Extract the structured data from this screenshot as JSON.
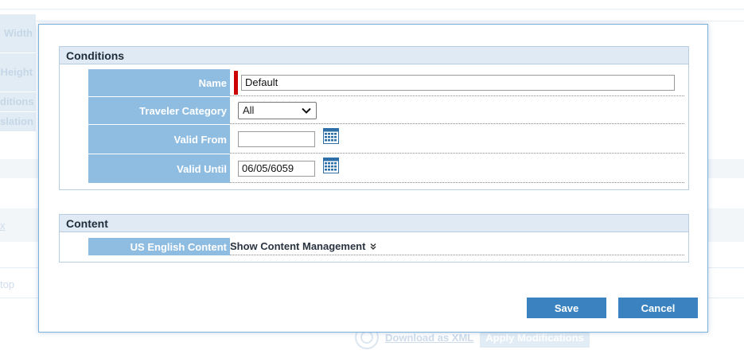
{
  "background": {
    "labels": [
      "Width",
      "Height",
      "ditions",
      "slation"
    ],
    "link_x": "x",
    "link_top": "top",
    "download_label": "Download as XML",
    "apply_label": "Apply Modifications"
  },
  "conditions": {
    "header": "Conditions",
    "name_label": "Name",
    "name_value": "Default",
    "traveler_label": "Traveler Category",
    "traveler_value": "All",
    "valid_from_label": "Valid From",
    "valid_from_value": "",
    "valid_until_label": "Valid Until",
    "valid_until_value": "06/05/6059"
  },
  "content": {
    "header": "Content",
    "us_english_label": "US English Content",
    "show_link": "Show Content Management"
  },
  "buttons": {
    "save": "Save",
    "cancel": "Cancel"
  },
  "colors": {
    "label_bg": "#8fbde2",
    "header_bg": "#dfeaf4",
    "button_bg": "#3b83c0",
    "required": "#cc0000"
  },
  "icons": {
    "calendar": "calendar-icon",
    "dropdown": "chevron-down-icon",
    "expand": "double-chevron-down-icon"
  }
}
